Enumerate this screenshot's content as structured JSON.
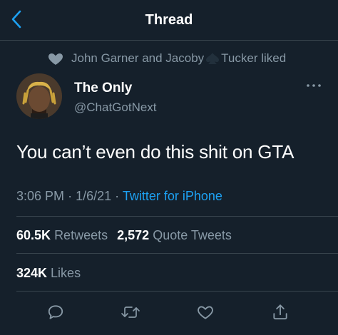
{
  "header": {
    "title": "Thread"
  },
  "social_context": {
    "text_before": "John Garner and Jacoby",
    "text_after": "Tucker liked"
  },
  "author": {
    "name": "The Only",
    "handle": "@ChatGotNext"
  },
  "tweet": {
    "text": "You can’t even do this shit on GTA"
  },
  "meta": {
    "time": "3:06 PM",
    "sep1": "·",
    "date": "1/6/21",
    "sep2": "·",
    "source": "Twitter for iPhone"
  },
  "stats": {
    "retweets_count": "60.5K",
    "retweets_label": "Retweets",
    "quotes_count": "2,572",
    "quotes_label": "Quote Tweets",
    "likes_count": "324K",
    "likes_label": "Likes"
  },
  "colors": {
    "background": "#15202b",
    "accent": "#1da1f2",
    "secondary_text": "#8899a6",
    "divider": "#38444d"
  },
  "icons": [
    "back-chevron-icon",
    "heart-icon",
    "spade-icon",
    "more-icon",
    "reply-icon",
    "retweet-icon",
    "like-icon",
    "share-icon"
  ]
}
